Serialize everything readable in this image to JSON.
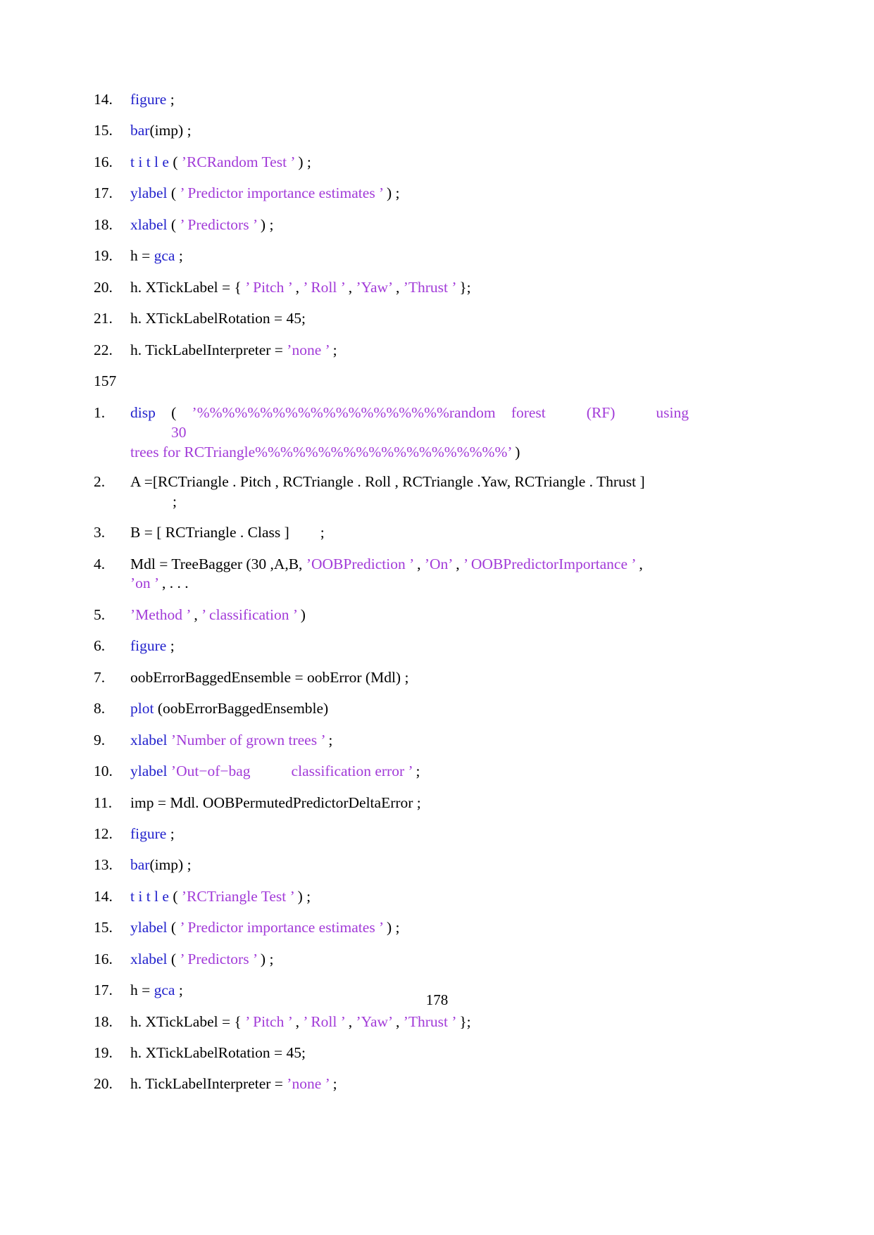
{
  "document": {
    "page_number": "178",
    "colors": {
      "keyword": "#2222cc",
      "string": "#a23bd8",
      "plain": "#000000",
      "background": "#ffffff"
    }
  },
  "listing_top": {
    "lines": [
      {
        "num": "14.",
        "segs": [
          {
            "t": "figure",
            "c": "kw"
          },
          {
            "t": " ;",
            "c": "plain"
          }
        ]
      },
      {
        "num": "15.",
        "segs": [
          {
            "t": "bar",
            "c": "kw"
          },
          {
            "t": "(imp) ;",
            "c": "plain"
          }
        ]
      },
      {
        "num": "16.",
        "segs": [
          {
            "t": "t i t l e",
            "c": "kw"
          },
          {
            "t": " ( ",
            "c": "plain"
          },
          {
            "t": "’RCRandom Test ’",
            "c": "str"
          },
          {
            "t": " ) ;",
            "c": "plain"
          }
        ]
      },
      {
        "num": "17.",
        "segs": [
          {
            "t": "ylabel",
            "c": "kw"
          },
          {
            "t": " ( ",
            "c": "plain"
          },
          {
            "t": "’ Predictor importance  estimates ’",
            "c": "str"
          },
          {
            "t": " ) ;",
            "c": "plain"
          }
        ]
      },
      {
        "num": "18.",
        "segs": [
          {
            "t": "xlabel",
            "c": "kw"
          },
          {
            "t": " ( ",
            "c": "plain"
          },
          {
            "t": "’ Predictors ’",
            "c": "str"
          },
          {
            "t": " ) ;",
            "c": "plain"
          }
        ]
      },
      {
        "num": "19.",
        "segs": [
          {
            "t": "h = ",
            "c": "plain"
          },
          {
            "t": "gca",
            "c": "kw"
          },
          {
            "t": " ;",
            "c": "plain"
          }
        ]
      },
      {
        "num": "20.",
        "segs": [
          {
            "t": "h. XTickLabel = { ",
            "c": "plain"
          },
          {
            "t": "’ Pitch ’",
            "c": "str"
          },
          {
            "t": " , ",
            "c": "plain"
          },
          {
            "t": "’ Roll ’",
            "c": "str"
          },
          {
            "t": " , ",
            "c": "plain"
          },
          {
            "t": "’Yaw’",
            "c": "str"
          },
          {
            "t": " , ",
            "c": "plain"
          },
          {
            "t": "’Thrust ’",
            "c": "str"
          },
          {
            "t": " };",
            "c": "plain"
          }
        ]
      },
      {
        "num": "21.",
        "segs": [
          {
            "t": "h. XTickLabelRotation = 45;",
            "c": "plain"
          }
        ]
      },
      {
        "num": "22.",
        "segs": [
          {
            "t": "h. TickLabelInterpreter = ",
            "c": "plain"
          },
          {
            "t": "’none ’",
            "c": "str"
          },
          {
            "t": " ;",
            "c": "plain"
          }
        ]
      }
    ]
  },
  "section_label": "157",
  "listing_bottom": {
    "line1": {
      "num": "1.",
      "kw": "disp",
      "open": " ( ",
      "str_a": "’%%%%%%%%%%%%%%%%%%%%random forest",
      "gap_word1": "(RF)",
      "gap_word2": "using",
      "gap_word3": "30",
      "str_b": "trees   for RCTriangle%%%%%%%%%%%%%%%%%%%%’",
      "close": " )"
    },
    "lines": [
      {
        "num": "2.",
        "segs": [
          {
            "t": "A =[RCTriangle . Pitch , RCTriangle . Roll , RCTriangle .Yaw, RCTriangle . Thrust ]",
            "c": "plain"
          }
        ],
        "semi_line": ";"
      },
      {
        "num": "3.",
        "segs": [
          {
            "t": "B = [ RCTriangle . Class ]",
            "c": "plain"
          },
          {
            "t": "__TAB__",
            "c": "gap"
          },
          {
            "t": ";",
            "c": "plain"
          }
        ]
      },
      {
        "num": "4.",
        "segs": [
          {
            "t": "Mdl = TreeBagger (30 ,A,B, ",
            "c": "plain"
          },
          {
            "t": "’OOBPrediction ’",
            "c": "str"
          },
          {
            "t": " , ",
            "c": "plain"
          },
          {
            "t": "’On’",
            "c": "str"
          },
          {
            "t": " , ",
            "c": "plain"
          },
          {
            "t": "’ OOBPredictorImportance ’",
            "c": "str"
          },
          {
            "t": " ,",
            "c": "plain"
          },
          {
            "t": "__BR__",
            "c": "br"
          },
          {
            "t": "’on ’",
            "c": "str"
          },
          {
            "t": " , . . .",
            "c": "plain"
          }
        ]
      },
      {
        "num": "5.",
        "segs": [
          {
            "t": "’Method ’",
            "c": "str"
          },
          {
            "t": " , ",
            "c": "plain"
          },
          {
            "t": "’ classification ’",
            "c": "str"
          },
          {
            "t": " )",
            "c": "plain"
          }
        ]
      },
      {
        "num": "6.",
        "segs": [
          {
            "t": "figure",
            "c": "kw"
          },
          {
            "t": " ;",
            "c": "plain"
          }
        ]
      },
      {
        "num": "7.",
        "segs": [
          {
            "t": "oobErrorBaggedEnsemble = oobError (Mdl) ;",
            "c": "plain"
          }
        ]
      },
      {
        "num": "8.",
        "segs": [
          {
            "t": "plot",
            "c": "kw"
          },
          {
            "t": " (oobErrorBaggedEnsemble)",
            "c": "plain"
          }
        ]
      },
      {
        "num": "9.",
        "segs": [
          {
            "t": "xlabel",
            "c": "kw"
          },
          {
            "t": " ",
            "c": "plain"
          },
          {
            "t": "’Number of grown trees ’",
            "c": "str"
          },
          {
            "t": " ;",
            "c": "plain"
          }
        ]
      },
      {
        "num": "10.",
        "segs": [
          {
            "t": "ylabel",
            "c": "kw"
          },
          {
            "t": " ",
            "c": "plain"
          },
          {
            "t": "’Out−of−bag",
            "c": "str"
          },
          {
            "t": "__GAP__",
            "c": "gap"
          },
          {
            "t": "classification   error ’",
            "c": "str"
          },
          {
            "t": " ;",
            "c": "plain"
          }
        ]
      },
      {
        "num": "11.",
        "segs": [
          {
            "t": "imp = Mdl. OOBPermutedPredictorDeltaError ;",
            "c": "plain"
          }
        ]
      },
      {
        "num": "12.",
        "segs": [
          {
            "t": "figure",
            "c": "kw"
          },
          {
            "t": " ;",
            "c": "plain"
          }
        ]
      },
      {
        "num": "13.",
        "segs": [
          {
            "t": "bar",
            "c": "kw"
          },
          {
            "t": "(imp) ;",
            "c": "plain"
          }
        ]
      },
      {
        "num": "14.",
        "segs": [
          {
            "t": "t i t l e",
            "c": "kw"
          },
          {
            "t": " ( ",
            "c": "plain"
          },
          {
            "t": "’RCTriangle Test ’",
            "c": "str"
          },
          {
            "t": " ) ;",
            "c": "plain"
          }
        ]
      },
      {
        "num": "15.",
        "segs": [
          {
            "t": "ylabel",
            "c": "kw"
          },
          {
            "t": " ( ",
            "c": "plain"
          },
          {
            "t": "’ Predictor importance  estimates ’",
            "c": "str"
          },
          {
            "t": " ) ;",
            "c": "plain"
          }
        ]
      },
      {
        "num": "16.",
        "segs": [
          {
            "t": "xlabel",
            "c": "kw"
          },
          {
            "t": " ( ",
            "c": "plain"
          },
          {
            "t": "’ Predictors ’",
            "c": "str"
          },
          {
            "t": " ) ;",
            "c": "plain"
          }
        ]
      },
      {
        "num": "17.",
        "segs": [
          {
            "t": "h = ",
            "c": "plain"
          },
          {
            "t": "gca",
            "c": "kw"
          },
          {
            "t": " ;",
            "c": "plain"
          }
        ]
      },
      {
        "num": "18.",
        "segs": [
          {
            "t": "h. XTickLabel = { ",
            "c": "plain"
          },
          {
            "t": "’ Pitch ’",
            "c": "str"
          },
          {
            "t": " , ",
            "c": "plain"
          },
          {
            "t": "’ Roll ’",
            "c": "str"
          },
          {
            "t": " , ",
            "c": "plain"
          },
          {
            "t": "’Yaw’",
            "c": "str"
          },
          {
            "t": " , ",
            "c": "plain"
          },
          {
            "t": "’Thrust ’",
            "c": "str"
          },
          {
            "t": " };",
            "c": "plain"
          }
        ]
      },
      {
        "num": "19.",
        "segs": [
          {
            "t": "h. XTickLabelRotation = 45;",
            "c": "plain"
          }
        ]
      },
      {
        "num": "20.",
        "segs": [
          {
            "t": "h. TickLabelInterpreter = ",
            "c": "plain"
          },
          {
            "t": "’none ’",
            "c": "str"
          },
          {
            "t": " ;",
            "c": "plain"
          }
        ]
      }
    ]
  }
}
